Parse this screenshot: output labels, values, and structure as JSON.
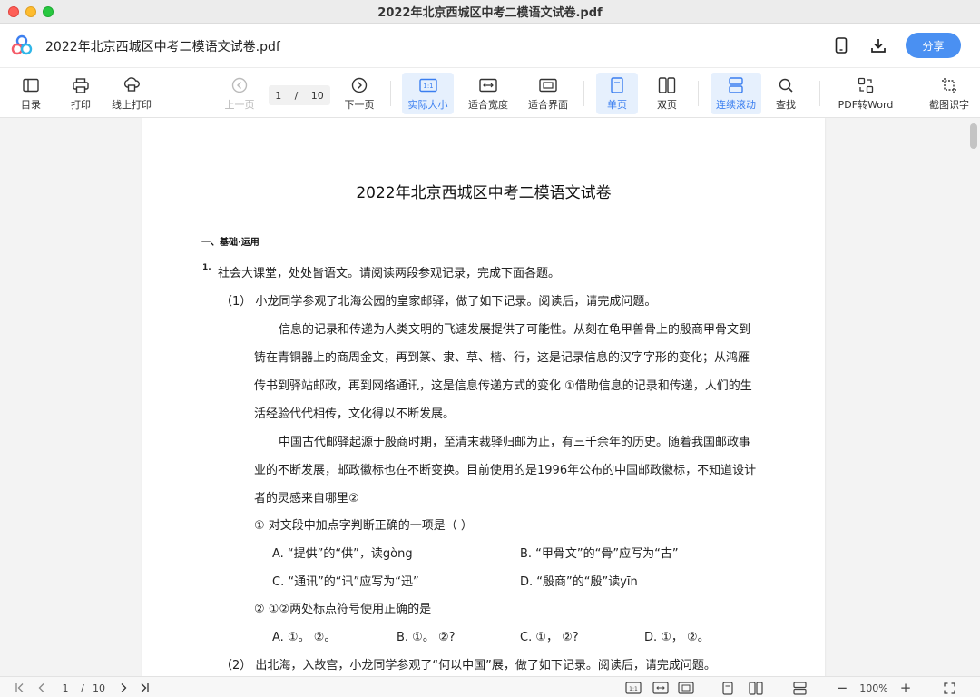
{
  "window": {
    "title": "2022年北京西城区中考二模语文试卷.pdf"
  },
  "header": {
    "filename": "2022年北京西城区中考二模语文试卷.pdf",
    "share_label": "分享"
  },
  "toolbar": {
    "toc": "目录",
    "print": "打印",
    "online_print": "线上打印",
    "prev_page": "上一页",
    "current_page": "1",
    "page_sep": "/",
    "total_pages": "10",
    "next_page": "下一页",
    "actual_size": "实际大小",
    "actual_size_glyph": "1:1",
    "fit_width": "适合宽度",
    "fit_page": "适合界面",
    "single_page": "单页",
    "double_page": "双页",
    "continuous": "连续滚动",
    "find": "查找",
    "pdf_to_word": "PDF转Word",
    "ocr": "截图识字"
  },
  "document": {
    "title": "2022年北京西城区中考二模语文试卷",
    "section": "一、基础·运用",
    "q1_number": "1.",
    "lines": [
      "社会大课堂，处处皆语文。请阅读两段参观记录，完成下面各题。",
      "（1） 小龙同学参观了北海公园的皇家邮驿，做了如下记录。阅读后，请完成问题。",
      "信息的记录和传递为人类文明的飞速发展提供了可能性。从刻在龟甲兽骨上的殷商甲骨文到",
      "铸在青铜器上的商周金文，再到篆、隶、草、楷、行，这是记录信息的汉字字形的变化；从鸿雁",
      "传书到驿站邮政，再到网络通讯，这是信息传递方式的变化 ①借助信息的记录和传递，人们的生",
      "活经验代代相传，文化得以不断发展。",
      "中国古代邮驿起源于殷商时期，至清末裁驿归邮为止，有三千余年的历史。随着我国邮政事",
      "业的不断发展，邮政徽标也在不断变换。目前使用的是1996年公布的中国邮政徽标，不知道设计",
      "者的灵感来自哪里②",
      "① 对文段中加点字判断正确的一项是（ ）",
      "A. “提供”的“供”，读gòng",
      "B. “甲骨文”的“骨”应写为“古”",
      "C. “通讯”的“讯”应写为“迅”",
      "D. “殷商”的“殷”读yīn",
      "② ①②两处标点符号使用正确的是",
      "A. ①。 ②。",
      "B. ①。 ②?",
      "C. ①， ②?",
      "D. ①， ②。",
      "（2） 出北海，入故宫，小龙同学参观了“何以中国”展，做了如下记录。阅读后，请完成问题。"
    ]
  },
  "statusbar": {
    "current_page": "1",
    "page_sep": "/",
    "total_pages": "10",
    "actual_size_glyph": "1:1",
    "zoom": "100%",
    "zoom_out": "−",
    "zoom_in": "+"
  }
}
